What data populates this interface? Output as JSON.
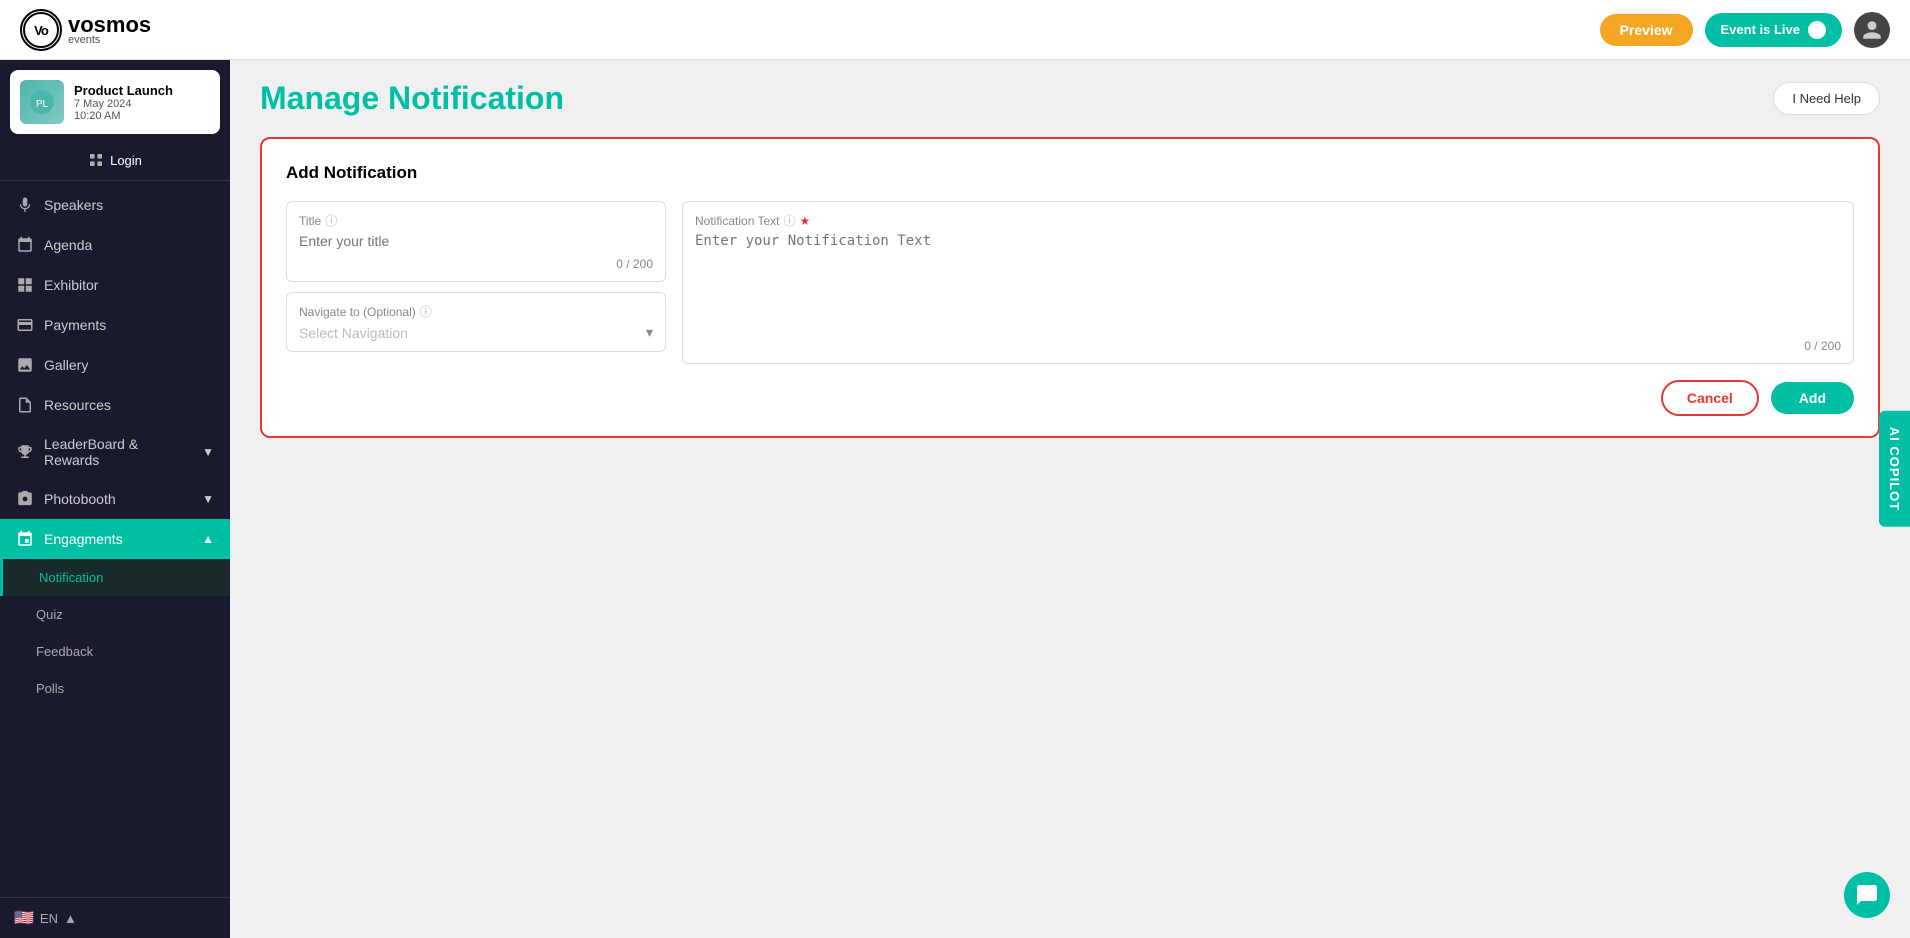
{
  "header": {
    "logo_text": "vosmos",
    "logo_sub": "events",
    "preview_label": "Preview",
    "live_label": "Event is Live",
    "help_label": "I Need Help"
  },
  "sidebar": {
    "event": {
      "title": "Product Launch",
      "date": "7 May 2024",
      "time": "10:20 AM"
    },
    "login_label": "Login",
    "items": [
      {
        "id": "speakers",
        "label": "Speakers",
        "icon": "mic"
      },
      {
        "id": "agenda",
        "label": "Agenda",
        "icon": "calendar"
      },
      {
        "id": "exhibitor",
        "label": "Exhibitor",
        "icon": "grid"
      },
      {
        "id": "payments",
        "label": "Payments",
        "icon": "credit-card"
      },
      {
        "id": "gallery",
        "label": "Gallery",
        "icon": "image"
      },
      {
        "id": "resources",
        "label": "Resources",
        "icon": "file"
      },
      {
        "id": "leaderboard",
        "label": "LeaderBoard & Rewards",
        "icon": "trophy",
        "has_chevron": true
      },
      {
        "id": "photobooth",
        "label": "Photobooth",
        "icon": "camera",
        "has_chevron": true
      },
      {
        "id": "engagments",
        "label": "Engagments",
        "icon": "engagement",
        "has_chevron": true,
        "active": true
      }
    ],
    "sub_items": [
      {
        "id": "notification",
        "label": "Notification",
        "active": true
      },
      {
        "id": "quiz",
        "label": "Quiz"
      },
      {
        "id": "feedback",
        "label": "Feedback"
      },
      {
        "id": "polls",
        "label": "Polls"
      }
    ],
    "lang": "EN",
    "flag": "🇺🇸"
  },
  "page": {
    "title": "Manage Notification"
  },
  "add_notification": {
    "section_title": "Add Notification",
    "title_field": {
      "label": "Title",
      "placeholder": "Enter your title",
      "counter": "0 / 200"
    },
    "navigate_field": {
      "label": "Navigate to (Optional)",
      "placeholder": "Select Navigation"
    },
    "notification_text_field": {
      "label": "Notification Text",
      "required": true,
      "placeholder": "Enter your Notification Text",
      "counter": "0 / 200"
    },
    "cancel_label": "Cancel",
    "add_label": "Add"
  },
  "ai_copilot_label": "AI COPILOT",
  "colors": {
    "accent": "#00bfa5",
    "preview_btn": "#f5a623",
    "danger": "#e53935"
  }
}
